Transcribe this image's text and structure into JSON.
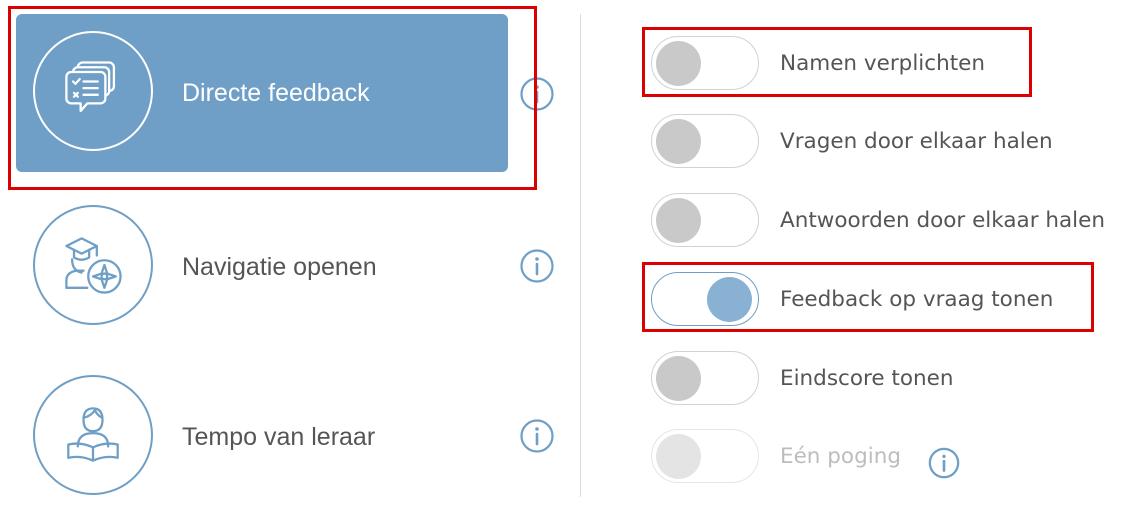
{
  "modes": [
    {
      "label": "Directe feedback",
      "icon": "feedback-cards-icon",
      "selected": true
    },
    {
      "label": "Navigatie openen",
      "icon": "student-compass-icon",
      "selected": false
    },
    {
      "label": "Tempo van leraar",
      "icon": "teacher-book-icon",
      "selected": false
    }
  ],
  "options": [
    {
      "label": "Namen verplichten",
      "state": "off"
    },
    {
      "label": "Vragen door elkaar halen",
      "state": "off"
    },
    {
      "label": "Antwoorden door elkaar halen",
      "state": "off"
    },
    {
      "label": "Feedback op vraag tonen",
      "state": "on"
    },
    {
      "label": "Eindscore tonen",
      "state": "off"
    },
    {
      "label": "Eén poging",
      "state": "disabled",
      "has_info": true
    }
  ],
  "colors": {
    "accent": "#6f9fc6",
    "toggle_on_knob": "#89b1d3",
    "toggle_off_knob": "#c9c9c9",
    "highlight": "#dd0000",
    "text": "#555555"
  }
}
